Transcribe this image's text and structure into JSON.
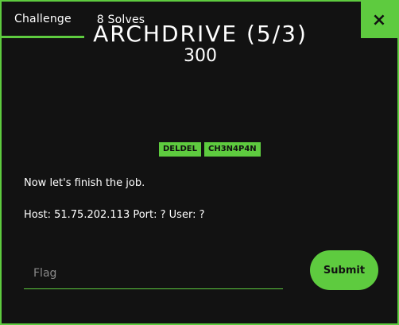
{
  "tabs": [
    {
      "label": "Challenge"
    },
    {
      "label": "8 Solves"
    }
  ],
  "close": {
    "label": "×"
  },
  "challenge": {
    "title": "ARCHDRIVE (5/3)",
    "points": "300",
    "tags": [
      "DELDEL",
      "CH3N4P4N"
    ],
    "description": [
      "Now let's finish the job.",
      "Host: 51.75.202.113 Port: ? User: ?"
    ]
  },
  "form": {
    "flag_placeholder": "Flag",
    "submit_label": "Submit"
  },
  "colors": {
    "accent": "#5ecb3f",
    "background": "#121212",
    "text": "#ffffff"
  }
}
